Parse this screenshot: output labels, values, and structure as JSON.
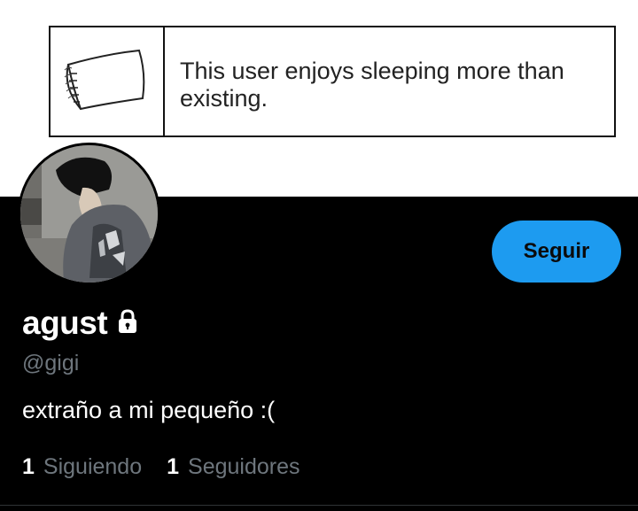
{
  "header": {
    "userbox_text": "This user enjoys sleeping more than existing."
  },
  "profile": {
    "display_name": "agust",
    "handle": "@gigi",
    "bio": "extraño a mi pequeño :(",
    "follow_button": "Seguir",
    "protected_icon": "lock-icon",
    "stats": {
      "following_count": "1",
      "following_label": "Siguiendo",
      "followers_count": "1",
      "followers_label": "Seguidores"
    }
  },
  "colors": {
    "accent": "#1d9bf0",
    "background": "#000000",
    "secondary_text": "#6e767d"
  }
}
